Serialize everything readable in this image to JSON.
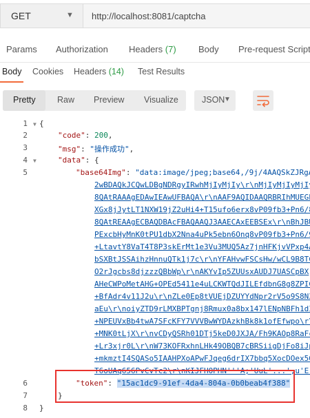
{
  "request": {
    "method": "GET",
    "url": "http://localhost:8081/captcha"
  },
  "request_tabs": [
    {
      "label": "Params"
    },
    {
      "label": "Authorization"
    },
    {
      "label": "Headers",
      "count": "(7)"
    },
    {
      "label": "Body"
    },
    {
      "label": "Pre-request Script"
    }
  ],
  "response_tabs": [
    {
      "label": "Body"
    },
    {
      "label": "Cookies"
    },
    {
      "label": "Headers",
      "count": "(14)"
    },
    {
      "label": "Test Results"
    }
  ],
  "format_options": [
    "Pretty",
    "Raw",
    "Preview",
    "Visualize"
  ],
  "format_language": "JSON",
  "code": {
    "line_numbers": [
      "1",
      "2",
      "3",
      "4",
      "5",
      "6",
      "7",
      "8"
    ],
    "open_brace": "{",
    "close_brace": "}",
    "code_key": "\"code\"",
    "code_value": "200",
    "msg_key": "\"msg\"",
    "msg_value": "\"操作成功\"",
    "data_key": "\"data\"",
    "base64_key": "\"base64Img\"",
    "base64_first": "\"data:image/jpeg;base64,/9j/4AAQSkZJRgA",
    "base64_lines": [
      "2wBDAQkJCQwLDBgNDRgyIRwhMjIyMjIy\\r\\nMjIyMjIyMjIy",
      "8QAtRAAAgEDAwIEAwUFBAQA\\r\\nAAF9AQIDAAQRBRIhMUEGE",
      "XGx8jJytLT1NXW19jZ2uHi4+T15ufo6erx8vP09fb3+Pn6/8",
      "8QAtREAAgECBAQDBAcFBAQAAQJ3AAECAxEEBSEx\\r\\nBhJBU",
      "PExcbHyMnK0tPU1dbX2Nna4uPk5ebn6Onq8vP09fb3+Pn6/9",
      "+LtavtY8VaT4T8P3skErMt1e3Vu3MUQ5Az7jnHFKjvVPxp4A",
      "bSXBtJSSAihzHnnuQTk1j7c\\r\\nYFAHvwFSCsHw/wCL9B8TC",
      "O2rJgcbs8djzzzQBbWp\\r\\nAKYvIp5ZUUsxAUDJ7UASCpBX",
      "AHeCWPoMetAHG+OPEd5411e4uLCKWTQdJILEfdbnG8g8ZPIC",
      "+BfAdr4v11J2u\\r\\nZLe0Ep8tVUEjDZUYYdNpr2rV5o9S8N3",
      "aEu\\r\\noiyZTD9rLMXBPTgnj8Rmux0a8bx147lENpNBFh1dI",
      "+NPEUVxBb4twA7SFcKFY7VVVBwWYDAzkhBk8k1ofEfwpo\\r\\",
      "+MNK0tLjX\\r\\nvCDyQSRh01DTj5keD0JXJA/Fh9KAOp8RaFc",
      "+Lr3xjr0L\\r\\nW73KOFRxhnLHk49OBQB7cBRSiigDjFo8iJp",
      "+mkmztI4SQASo5IAAHPXoAPwFJqeg6drIX7bbq5XocDOex56",
      "T6oUAq656PvCvTc2\\r\\nKIJFHOPHN'''A;'UuL'...',u'E:c/'A'fC/"
    ],
    "token_key": "\"token\"",
    "token_value": "\"15ac1dc9-91ef-4da4-804a-0b0beab4f388\""
  },
  "colors": {
    "accent": "#f26b3a",
    "count_green": "#2e9b45",
    "highlight_red": "#e8322d",
    "selection_blue": "#c8dcf5",
    "string_blue": "#0451a5",
    "key_red": "#a31515",
    "number_green": "#098658"
  }
}
